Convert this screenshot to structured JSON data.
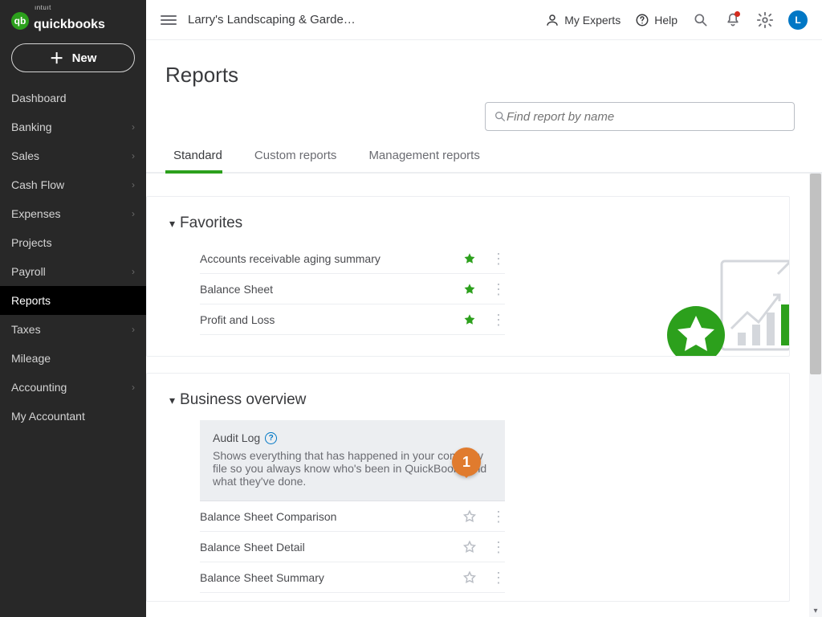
{
  "brand": {
    "badge": "qb",
    "intuit": "ıntuıt",
    "word": "quickbooks"
  },
  "sidebar": {
    "new_label": "New",
    "items": [
      {
        "label": "Dashboard",
        "chev": false,
        "active": false
      },
      {
        "label": "Banking",
        "chev": true,
        "active": false
      },
      {
        "label": "Sales",
        "chev": true,
        "active": false
      },
      {
        "label": "Cash Flow",
        "chev": true,
        "active": false
      },
      {
        "label": "Expenses",
        "chev": true,
        "active": false
      },
      {
        "label": "Projects",
        "chev": false,
        "active": false
      },
      {
        "label": "Payroll",
        "chev": true,
        "active": false
      },
      {
        "label": "Reports",
        "chev": false,
        "active": true
      },
      {
        "label": "Taxes",
        "chev": true,
        "active": false
      },
      {
        "label": "Mileage",
        "chev": false,
        "active": false
      },
      {
        "label": "Accounting",
        "chev": true,
        "active": false
      },
      {
        "label": "My Accountant",
        "chev": false,
        "active": false
      }
    ]
  },
  "topbar": {
    "company": "Larry's Landscaping & Garde…",
    "my_experts": "My Experts",
    "help": "Help",
    "avatar_letter": "L"
  },
  "page": {
    "title": "Reports",
    "search_placeholder": "Find report by name",
    "tabs": [
      {
        "label": "Standard",
        "active": true
      },
      {
        "label": "Custom reports",
        "active": false
      },
      {
        "label": "Management reports",
        "active": false
      }
    ]
  },
  "favorites": {
    "heading": "Favorites",
    "rows": [
      {
        "name": "Accounts receivable aging summary",
        "starred": true
      },
      {
        "name": "Balance Sheet",
        "starred": true
      },
      {
        "name": "Profit and Loss",
        "starred": true
      }
    ]
  },
  "business_overview": {
    "heading": "Business overview",
    "tip": {
      "title": "Audit Log",
      "body": "Shows everything that has happened in your company file so you always know who's been in QuickBooks and what they've done."
    },
    "rows": [
      {
        "name": "Balance Sheet Comparison",
        "starred": false
      },
      {
        "name": "Balance Sheet Detail",
        "starred": false
      },
      {
        "name": "Balance Sheet Summary",
        "starred": false
      }
    ]
  },
  "step_marker": "1"
}
